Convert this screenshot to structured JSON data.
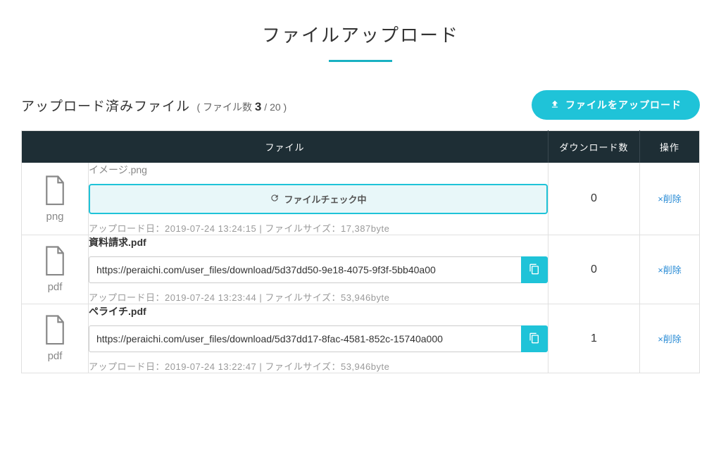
{
  "page": {
    "title": "ファイルアップロード"
  },
  "subheader": {
    "label": "アップロード済みファイル",
    "count_prefix": "( ファイル数 ",
    "count_current": "3",
    "count_sep": " / ",
    "count_max": "20",
    "count_suffix": " )"
  },
  "buttons": {
    "upload": "ファイルをアップロード"
  },
  "table": {
    "headers": {
      "file": "ファイル",
      "downloads": "ダウンロード数",
      "actions": "操作"
    }
  },
  "checking_label": "ファイルチェック中",
  "meta_labels": {
    "upload_date_prefix": "アップロード日：",
    "separator": " | ",
    "filesize_prefix": "ファイルサイズ：",
    "filesize_suffix": "byte"
  },
  "delete_label": "×削除",
  "files": [
    {
      "ext": "png",
      "name": "イメージ.png",
      "name_light": true,
      "checking": true,
      "url": "",
      "upload_date": "2019-07-24 13:24:15",
      "filesize": "17,387",
      "downloads": "0"
    },
    {
      "ext": "pdf",
      "name": "資料請求.pdf",
      "name_light": false,
      "checking": false,
      "url": "https://peraichi.com/user_files/download/5d37dd50-9e18-4075-9f3f-5bb40a00",
      "upload_date": "2019-07-24 13:23:44",
      "filesize": "53,946",
      "downloads": "0"
    },
    {
      "ext": "pdf",
      "name": "ペライチ.pdf",
      "name_light": false,
      "checking": false,
      "url": "https://peraichi.com/user_files/download/5d37dd17-8fac-4581-852c-15740a000",
      "upload_date": "2019-07-24 13:22:47",
      "filesize": "53,946",
      "downloads": "1"
    }
  ]
}
